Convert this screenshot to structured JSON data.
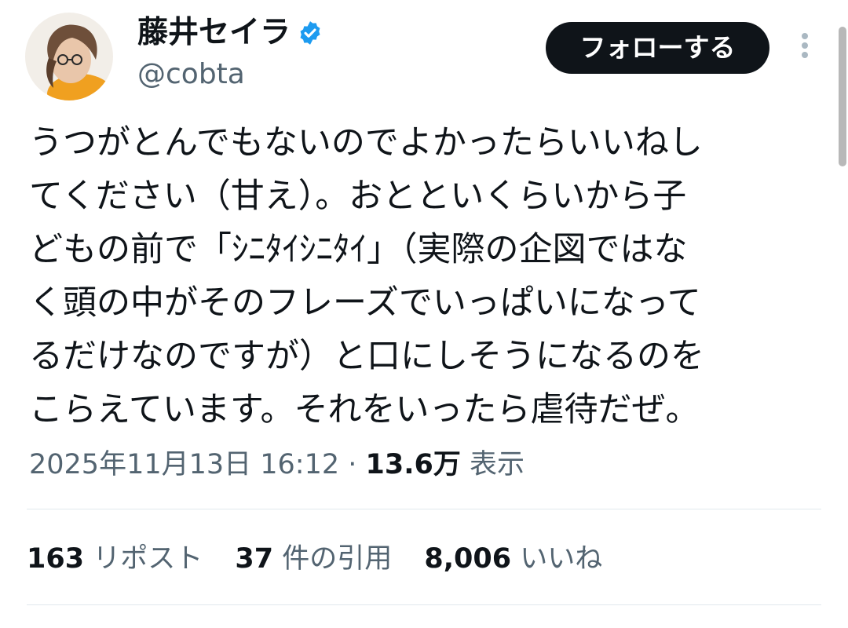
{
  "header": {
    "display_name": "藤井セイラ",
    "handle": "@cobta",
    "follow_label": "フォローする",
    "verified_color": "#1d9bf0"
  },
  "tweet": {
    "lines": [
      "うつがとんでもないのでよかったらいいねし",
      "てください（甘え）。おとといくらいから子",
      "どもの前で「ｼﾆﾀｲｼﾆﾀｲ」（実際の企図ではな",
      "く頭の中がそのフレーズでいっぱいになって",
      "るだけなのですが）と口にしそうになるのを",
      "こらえています。それをいったら虐待だぜ。"
    ],
    "timestamp": "2025年11月13日 16:12",
    "separator": " · ",
    "views_count": "13.6万",
    "views_label": "表示"
  },
  "stats": {
    "reposts_count": "163",
    "reposts_label": "リポスト",
    "quotes_count": "37",
    "quotes_label": "件の引用",
    "likes_count": "8,006",
    "likes_label": "いいね"
  },
  "icons": {
    "verified": "verified-badge-icon",
    "more": "more-vertical-icon"
  },
  "colors": {
    "text": "#0f1419",
    "secondary": "#536471",
    "button_bg": "#0f1419",
    "divider": "#e1e8ed"
  }
}
